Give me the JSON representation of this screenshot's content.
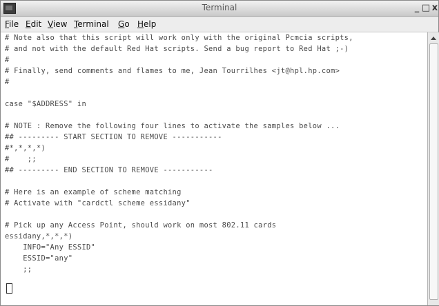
{
  "window": {
    "title": "Terminal",
    "icon": "terminal-icon",
    "controls": {
      "minimize": "_",
      "maximize": "□",
      "close": "x"
    }
  },
  "menubar": {
    "items": [
      {
        "label": "File",
        "mnemonic": "F",
        "rest": "ile"
      },
      {
        "label": "Edit",
        "mnemonic": "E",
        "rest": "dit"
      },
      {
        "label": "View",
        "mnemonic": "V",
        "rest": "iew"
      },
      {
        "label": "Terminal",
        "mnemonic": "T",
        "rest": "erminal"
      },
      {
        "label": "Go",
        "mnemonic": "G",
        "rest": "o"
      },
      {
        "label": "Help",
        "mnemonic": "H",
        "rest": "elp"
      }
    ]
  },
  "terminal": {
    "lines": [
      "# Note also that this script will work only with the original Pcmcia scripts,",
      "# and not with the default Red Hat scripts. Send a bug report to Red Hat ;-)",
      "#",
      "# Finally, send comments and flames to me, Jean Tourrilhes <jt@hpl.hp.com>",
      "#",
      "",
      "case \"$ADDRESS\" in",
      "",
      "# NOTE : Remove the following four lines to activate the samples below ...",
      "## --------- START SECTION TO REMOVE -----------",
      "#*,*,*,*)",
      "#    ;;",
      "## --------- END SECTION TO REMOVE -----------",
      "",
      "# Here is an example of scheme matching",
      "# Activate with \"cardctl scheme essidany\"",
      "",
      "# Pick up any Access Point, should work on most 802.11 cards",
      "essidany,*,*,*)",
      "    INFO=\"Any ESSID\"",
      "    ESSID=\"any\"",
      "    ;;",
      ""
    ]
  }
}
